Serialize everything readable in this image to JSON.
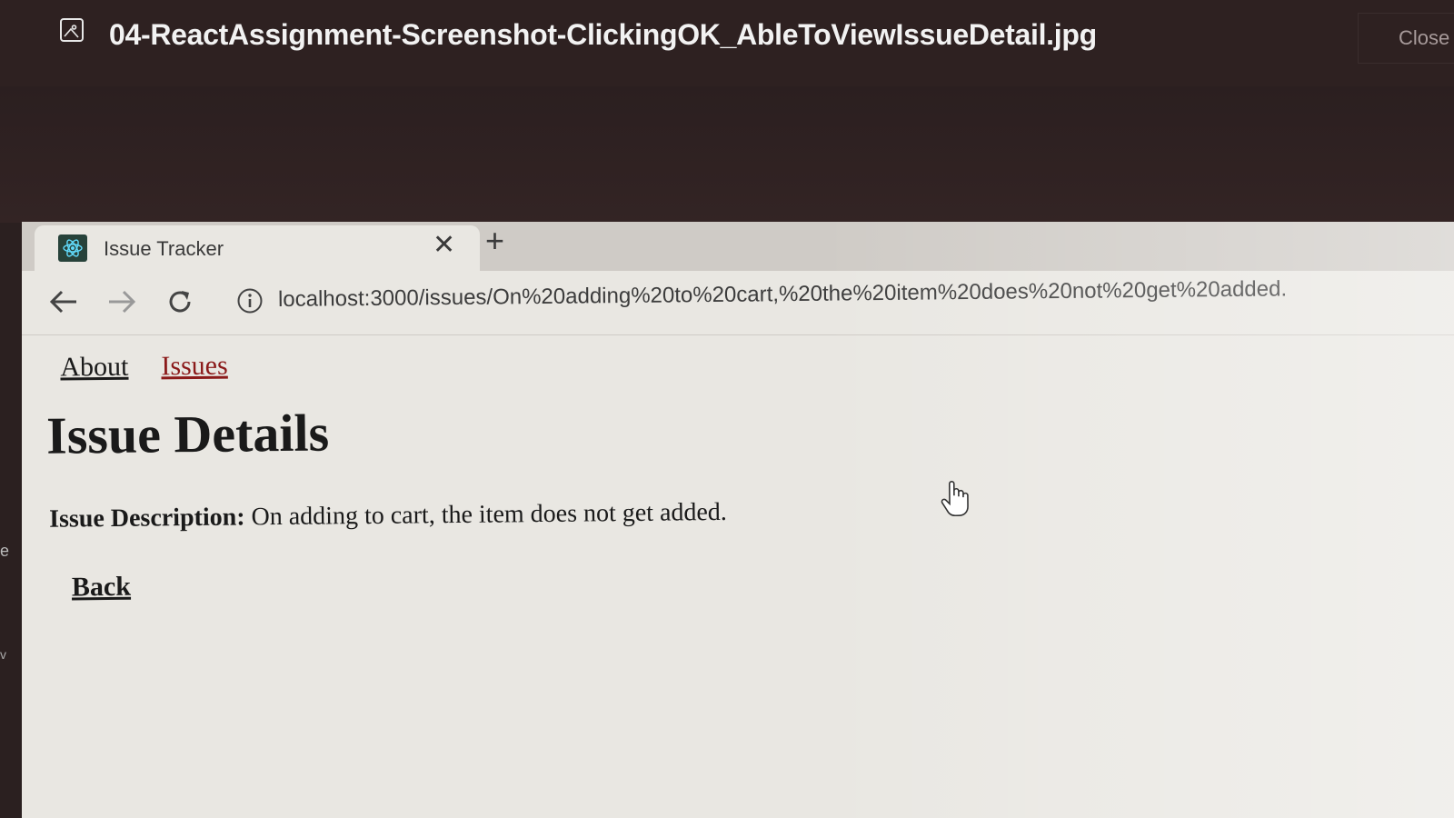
{
  "viewer": {
    "title": "04-ReactAssignment-Screenshot-ClickingOK_AbleToViewIssueDetail.jpg",
    "close_label": "Close",
    "edge_left_char_1": "e",
    "edge_left_char_2": "v"
  },
  "browser": {
    "tab_title": "Issue Tracker",
    "tab_close_glyph": "✕",
    "new_tab_glyph": "+",
    "url": "localhost:3000/issues/On%20adding%20to%20cart,%20the%20item%20does%20not%20get%20added."
  },
  "page": {
    "nav": [
      {
        "label": "About"
      },
      {
        "label": "Issues"
      }
    ],
    "title": "Issue Details",
    "description_label": "Issue Description:",
    "description_value": "On adding to cart, the item does not get added.",
    "back_label": "Back"
  },
  "icons": {
    "viewer": "image-icon",
    "favicon": "react-logo-icon",
    "back": "arrow-left-icon",
    "forward": "arrow-right-icon",
    "reload": "reload-icon",
    "info": "info-icon",
    "cursor": "hand-pointer-icon"
  },
  "colors": {
    "viewer_bg": "#2e2121",
    "page_bg": "#e9e7e2",
    "active_link": "#8b1a1a"
  }
}
